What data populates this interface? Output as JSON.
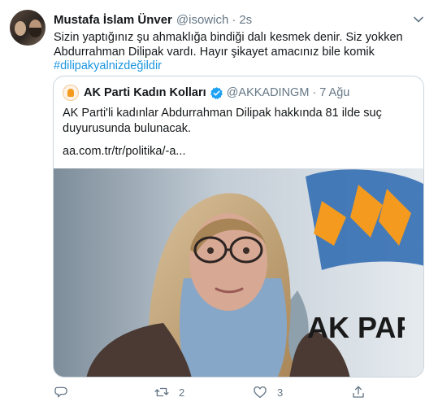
{
  "tweet": {
    "author_name": "Mustafa İslam Ünver",
    "author_handle": "@isowich",
    "separator": "·",
    "time": "2s",
    "text": "Sizin yaptığınız şu ahmaklığa bindiği dalı kesmek denir. Siz yokken Abdurrahman Dilipak vardı. Hayır şikayet amacınız bile komik",
    "hashtag": "#dilipakyalnizdeğildir"
  },
  "quote": {
    "author_name": "AK Parti Kadın Kolları",
    "author_handle": "@AKKADINGM",
    "separator": "·",
    "time": "7 Ağu",
    "text": "AK Parti'li kadınlar Abdurrahman Dilipak hakkında 81 ilde suç duyurusunda bulunacak.",
    "link": "aa.com.tr/tr/politika/-a...",
    "photo_logo_text": "AK PAR"
  },
  "actions": {
    "reply_count": "",
    "retweet_count": "2",
    "like_count": "3",
    "share_count": ""
  },
  "colors": {
    "text_primary": "#14171a",
    "text_secondary": "#657786",
    "link_blue": "#1b95e0",
    "verified_blue": "#1da1f2",
    "border": "#ccd6dd"
  },
  "icons": [
    "chevron-down-icon",
    "verified-badge-icon",
    "reply-icon",
    "retweet-icon",
    "like-icon",
    "share-icon"
  ]
}
